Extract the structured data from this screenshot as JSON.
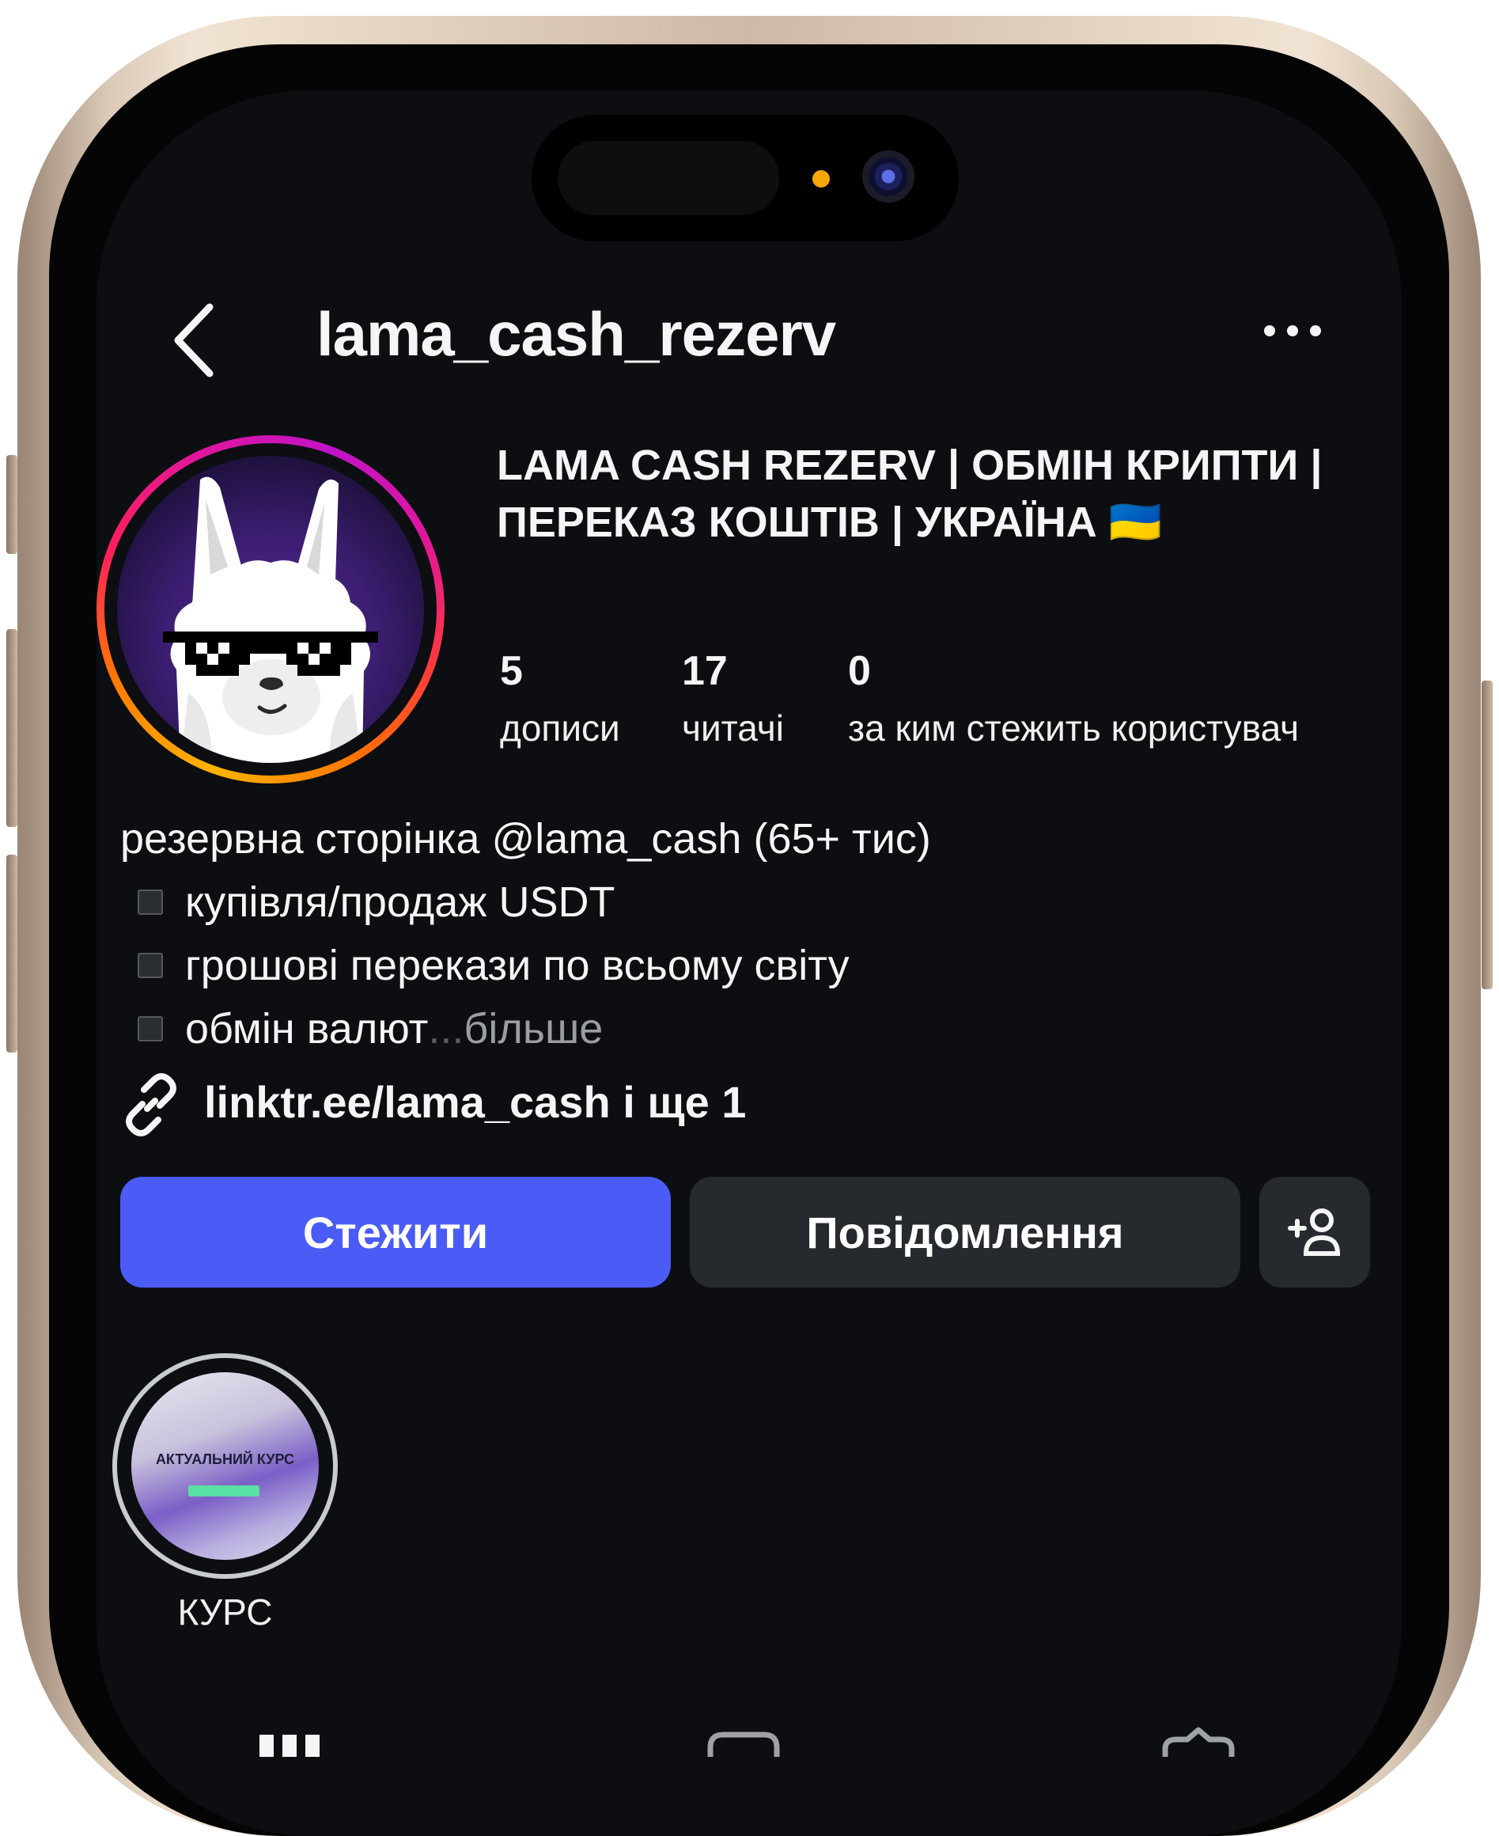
{
  "header": {
    "username": "lama_cash_rezerv",
    "back_icon": "chevron-left-icon",
    "more_icon": "more-horizontal-icon"
  },
  "profile": {
    "full_name": "LAMA CASH REZERV | ОБМІН КРИПТИ | ПЕРЕКАЗ КОШТІВ | УКРАЇНА 🇺🇦",
    "stats": {
      "posts_count": "5",
      "posts_label": "дописи",
      "followers_count": "17",
      "followers_label": "читачі",
      "following_count": "0",
      "following_label": "за ким стежить користувач"
    },
    "bio": {
      "line1": "резервна сторінка @lama_cash (65+ тис)",
      "line2": "купівля/продаж USDT",
      "line3": "грошові перекази по всьому світу",
      "line4": "обмін валют",
      "ellipsis": "...",
      "more": " більше"
    },
    "link": "linktr.ee/lama_cash і ще 1"
  },
  "actions": {
    "follow": "Стежити",
    "message": "Повідомлення",
    "add_user_icon": "add-user-icon"
  },
  "highlights": [
    {
      "label": "КУРС",
      "cover_text": "АКТУАЛЬНИЙ КУРС"
    }
  ],
  "colors": {
    "background": "#0c0e12",
    "follow_button": "#4a5cf5",
    "secondary_button": "#26292e",
    "story_ring_start": "#ffb300",
    "story_ring_end": "#c013c8"
  }
}
